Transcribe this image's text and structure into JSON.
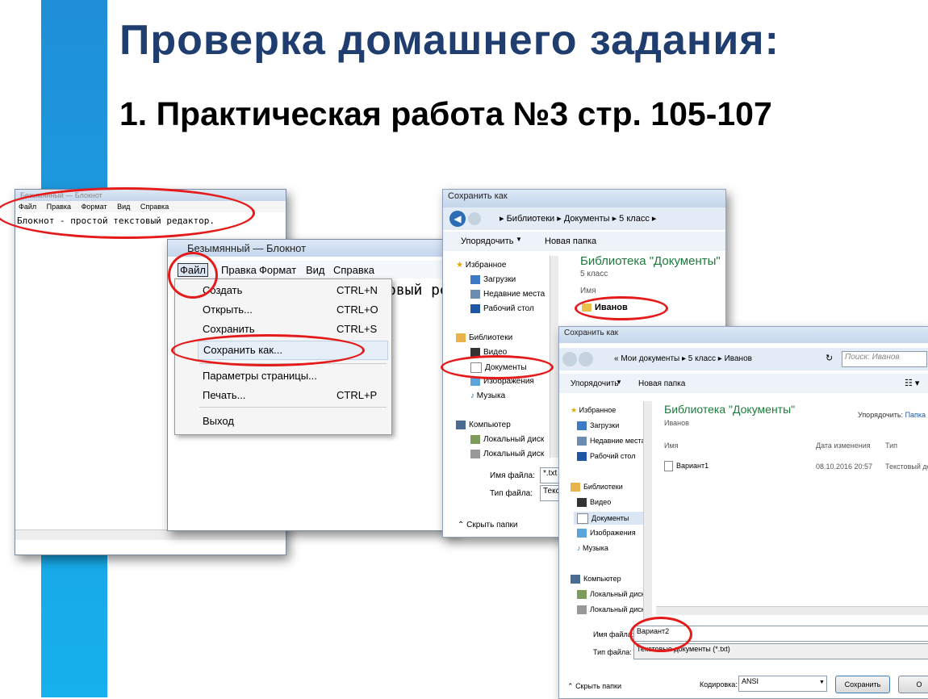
{
  "slide": {
    "title": "Проверка домашнего задания:",
    "subtitle": "1. Практическая работа №3 стр. 105-107"
  },
  "notepad_back": {
    "title": "Безымянный — Блокнот",
    "menu": [
      "Файл",
      "Правка",
      "Формат",
      "Вид",
      "Справка"
    ],
    "text": "Блокнот - простой текстовый редактор."
  },
  "notepad_front": {
    "title": "Безымянный — Блокнот",
    "menu": [
      "Файл",
      "Правка",
      "Формат",
      "Вид",
      "Справка"
    ],
    "text_fragment": "овый ре",
    "file_menu": [
      {
        "label": "Создать",
        "shortcut": "CTRL+N"
      },
      {
        "label": "Открыть...",
        "shortcut": "CTRL+O"
      },
      {
        "label": "Сохранить",
        "shortcut": "CTRL+S"
      },
      {
        "label": "Сохранить как...",
        "shortcut": ""
      },
      {
        "label": "Параметры страницы...",
        "shortcut": ""
      },
      {
        "label": "Печать...",
        "shortcut": "CTRL+P"
      },
      {
        "label": "Выход",
        "shortcut": ""
      }
    ]
  },
  "save_dialog_1": {
    "title": "Сохранить как",
    "path": [
      "Библиотеки",
      "Документы",
      "5 класс"
    ],
    "organize": "Упорядочить",
    "new_folder": "Новая папка",
    "library_title": "Библиотека \"Документы\"",
    "library_sub": "5 класс",
    "col_name": "Имя",
    "folder": "Иванов",
    "nav": {
      "favorites": "Избранное",
      "downloads": "Загрузки",
      "recent": "Недавние места",
      "desktop": "Рабочий стол",
      "libraries": "Библиотеки",
      "video": "Видео",
      "documents": "Документы",
      "images": "Изображения",
      "music": "Музыка",
      "computer": "Компьютер",
      "local1": "Локальный диск",
      "local2": "Локальный диск"
    },
    "filename_label": "Имя файла:",
    "filename_value": "*.txt",
    "filetype_label": "Тип файла:",
    "filetype_value": "Текс",
    "hide_folders": "Скрыть папки"
  },
  "save_dialog_2": {
    "title": "Сохранить как",
    "path": [
      "Мои документы",
      "5 класс",
      "Иванов"
    ],
    "search_placeholder": "Поиск: Иванов",
    "organize": "Упорядочить",
    "new_folder": "Новая папка",
    "library_title": "Библиотека \"Документы\"",
    "library_sub": "Иванов",
    "arrange_label": "Упорядочить:",
    "arrange_value": "Папка",
    "col_name": "Имя",
    "col_date": "Дата изменения",
    "col_type": "Тип",
    "file": {
      "name": "Вариант1",
      "date": "08.10.2016 20:57",
      "type": "Текстовый до"
    },
    "nav": {
      "favorites": "Избранное",
      "downloads": "Загрузки",
      "recent": "Недавние места",
      "desktop": "Рабочий стол",
      "libraries": "Библиотеки",
      "video": "Видео",
      "documents": "Документы",
      "images": "Изображения",
      "music": "Музыка",
      "computer": "Компьютер",
      "local1": "Локальный диск",
      "local2": "Локальный диск"
    },
    "filename_label": "Имя файла:",
    "filename_value": "Вариант2",
    "filetype_label": "Тип файла:",
    "filetype_value": "Текстовые документы (*.txt)",
    "hide_folders": "Скрыть папки",
    "encoding_label": "Кодировка:",
    "encoding_value": "ANSI",
    "save_button": "Сохранить",
    "cancel_button": "О"
  },
  "colors": {
    "stripe": "#1f8fd8",
    "title": "#1f3d6e",
    "annotation": "#e51b1b",
    "library_green": "#1e7a3c"
  }
}
